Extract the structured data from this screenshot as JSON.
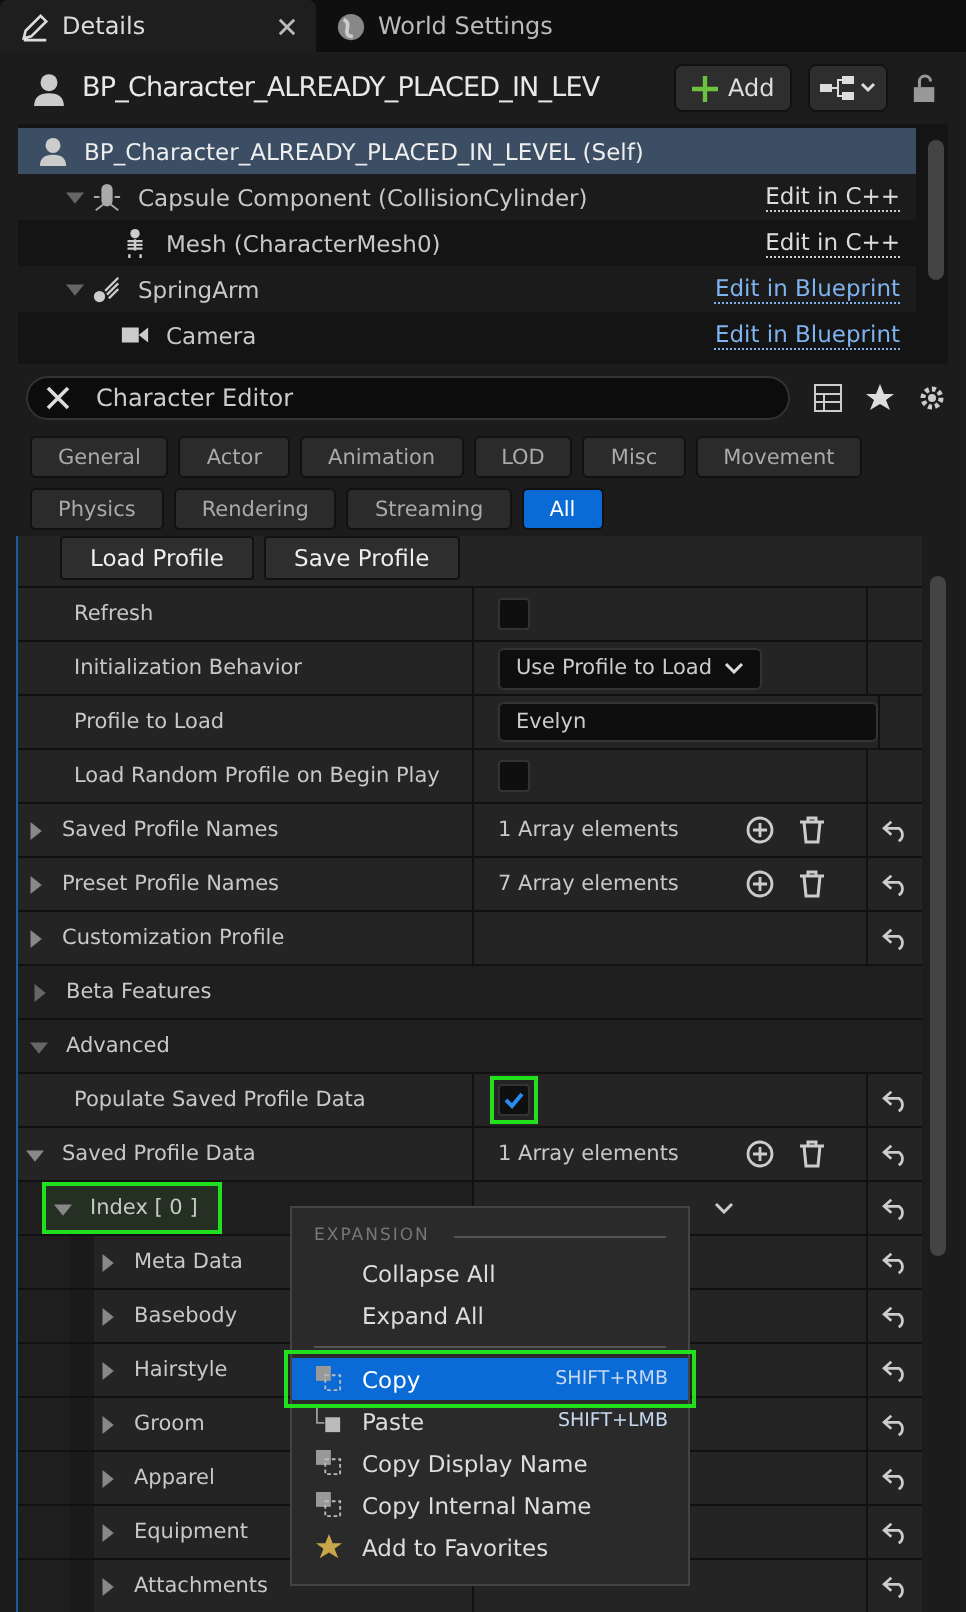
{
  "tabs": [
    {
      "label": "Details",
      "selected": true
    },
    {
      "label": "World Settings",
      "selected": false
    }
  ],
  "header": {
    "title": "BP_Character_ALREADY_PLACED_IN_LEV",
    "add_button": "Add"
  },
  "components": [
    {
      "label": "BP_Character_ALREADY_PLACED_IN_LEVEL (Self)",
      "selected": true,
      "children": [
        {
          "label": "Capsule Component (CollisionCylinder)",
          "selected": false,
          "link": "Edit in C++",
          "expanded": true,
          "children": [
            {
              "label": "Mesh (CharacterMesh0)",
              "selected": false,
              "link": "Edit in C++"
            }
          ]
        },
        {
          "label": "SpringArm",
          "selected": false,
          "link": "Edit in Blueprint",
          "expanded": true,
          "children": [
            {
              "label": "Camera",
              "selected": false,
              "link": "Edit in Blueprint"
            }
          ]
        }
      ]
    }
  ],
  "search": {
    "value": "Character Editor"
  },
  "filters": [
    {
      "label": "General",
      "selected": false
    },
    {
      "label": "Actor",
      "selected": false
    },
    {
      "label": "Animation",
      "selected": false
    },
    {
      "label": "LOD",
      "selected": false
    },
    {
      "label": "Misc",
      "selected": false
    },
    {
      "label": "Movement",
      "selected": false
    },
    {
      "label": "Physics",
      "selected": false
    },
    {
      "label": "Rendering",
      "selected": false
    },
    {
      "label": "Streaming",
      "selected": false
    },
    {
      "label": "All",
      "selected": true
    }
  ],
  "action_buttons": [
    "Load Profile",
    "Save Profile"
  ],
  "properties": [
    {
      "kind": "checkbox",
      "name": "Refresh",
      "checked": false,
      "highlighted": false
    },
    {
      "kind": "combo",
      "name": "Initialization Behavior",
      "value": "Use Profile to Load"
    },
    {
      "kind": "text",
      "name": "Profile to Load",
      "value": "Evelyn"
    },
    {
      "kind": "checkbox",
      "name": "Load Random Profile on Begin Play",
      "checked": false,
      "highlighted": false
    },
    {
      "kind": "array",
      "name": "Saved Profile Names",
      "value": "1 Array elements",
      "expanded": false
    },
    {
      "kind": "array",
      "name": "Preset Profile Names",
      "value": "7 Array elements",
      "expanded": false
    },
    {
      "kind": "struct",
      "name": "Customization Profile",
      "expanded": false
    },
    {
      "kind": "category",
      "name": "Beta Features",
      "expanded": false
    },
    {
      "kind": "category",
      "name": "Advanced",
      "expanded": true
    },
    {
      "kind": "checkbox",
      "name": "Populate Saved Profile Data",
      "checked": true,
      "highlighted": true
    },
    {
      "kind": "array",
      "name": "Saved Profile Data",
      "value": "1 Array elements",
      "expanded": true
    },
    {
      "kind": "element",
      "name": "Index [ 0 ]",
      "expanded": true,
      "highlighted": true,
      "children": [
        {
          "name": "Meta Data",
          "expanded": false
        },
        {
          "name": "Basebody",
          "expanded": false
        },
        {
          "name": "Hairstyle",
          "expanded": false
        },
        {
          "name": "Groom",
          "expanded": false
        },
        {
          "name": "Apparel",
          "expanded": false
        },
        {
          "name": "Equipment",
          "expanded": false
        },
        {
          "name": "Attachments",
          "expanded": false
        }
      ]
    }
  ],
  "context_menu": {
    "section": "EXPANSION",
    "groups": [
      [
        {
          "label": "Collapse All",
          "selected": false,
          "highlighted": false
        },
        {
          "label": "Expand All",
          "selected": false,
          "highlighted": false
        }
      ],
      [
        {
          "label": "Copy",
          "shortcut": "SHIFT+RMB",
          "selected": true,
          "highlighted": true
        },
        {
          "label": "Paste",
          "shortcut": "SHIFT+LMB",
          "selected": false,
          "highlighted": false
        },
        {
          "label": "Copy Display Name",
          "selected": false,
          "highlighted": false
        },
        {
          "label": "Copy Internal Name",
          "selected": false,
          "highlighted": false
        },
        {
          "label": "Add to Favorites",
          "selected": false,
          "highlighted": false
        }
      ]
    ]
  }
}
